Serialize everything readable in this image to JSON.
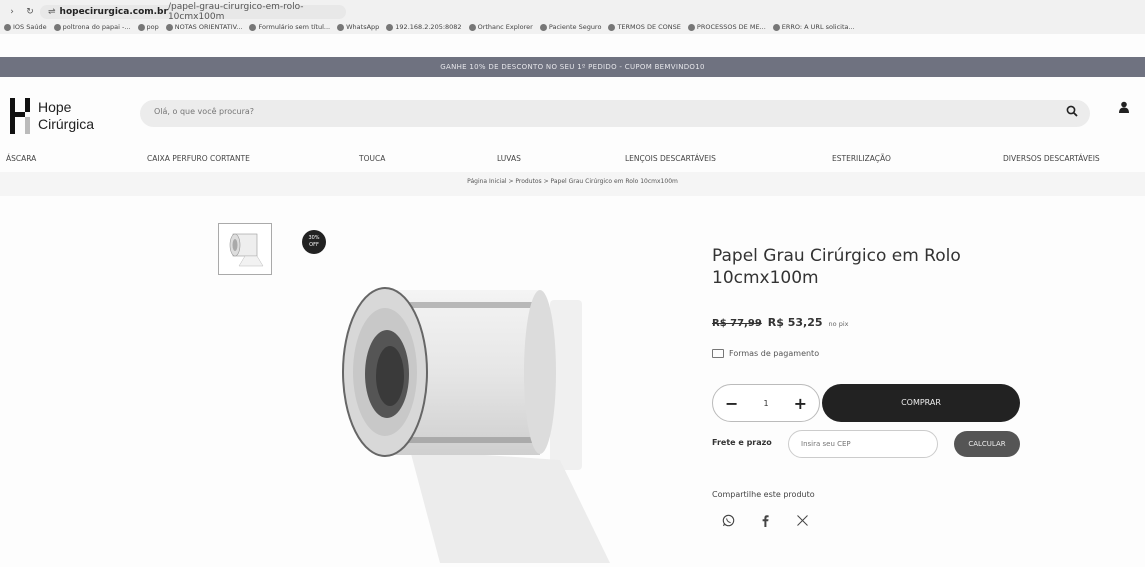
{
  "browser": {
    "url_host": "hopecirurgica.com.br",
    "url_path": "/papel-grau-cirurgico-em-rolo-10cmx100m",
    "bookmarks": [
      "IOS Saúde",
      "poltrona do papai -...",
      "pop",
      "NOTAS ORIENTATIV...",
      "Formulário sem títul...",
      "WhatsApp",
      "192.168.2.205:8082",
      "Orthanc Explorer",
      "Paciente Seguro",
      "TERMOS DE CONSE",
      "PROCESSOS DE ME...",
      "ERRO: A URL solicita..."
    ]
  },
  "promo_bar": "GANHE 10% DE DESCONTO NO SEU 1º PEDIDO - CUPOM BEMVINDO10",
  "header": {
    "logo_line1": "Hope",
    "logo_line2": "Cirúrgica",
    "search_placeholder": "Olá, o que você procura?"
  },
  "menu": [
    "ÁSCARA",
    "CAIXA PERFURO CORTANTE",
    "TOUCA",
    "LUVAS",
    "LENÇOIS DESCARTÁVEIS",
    "ESTERILIZAÇÃO",
    "DIVERSOS DESCARTÁVEIS"
  ],
  "breadcrumb": "Página Inicial > Produtos > Papel Grau Cirúrgico em Rolo 10cmx100m",
  "badge": {
    "line1": "30%",
    "line2": "OFF"
  },
  "product": {
    "title": "Papel Grau Cirúrgico em Rolo 10cmx100m",
    "old_price": "R$ 77,99",
    "new_price": "R$ 53,25",
    "pix_label": "no pix",
    "payment_label": "Formas de pagamento",
    "quantity": "1",
    "buy_label": "COMPRAR",
    "shipping_label": "Frete e prazo",
    "cep_placeholder": "Insira seu CEP",
    "calc_label": "CALCULAR",
    "share_label": "Compartilhe este produto"
  },
  "icons": {
    "search": "search-icon",
    "account": "user-icon",
    "whatsapp": "whatsapp-icon",
    "facebook": "facebook-icon",
    "x": "x-icon"
  }
}
